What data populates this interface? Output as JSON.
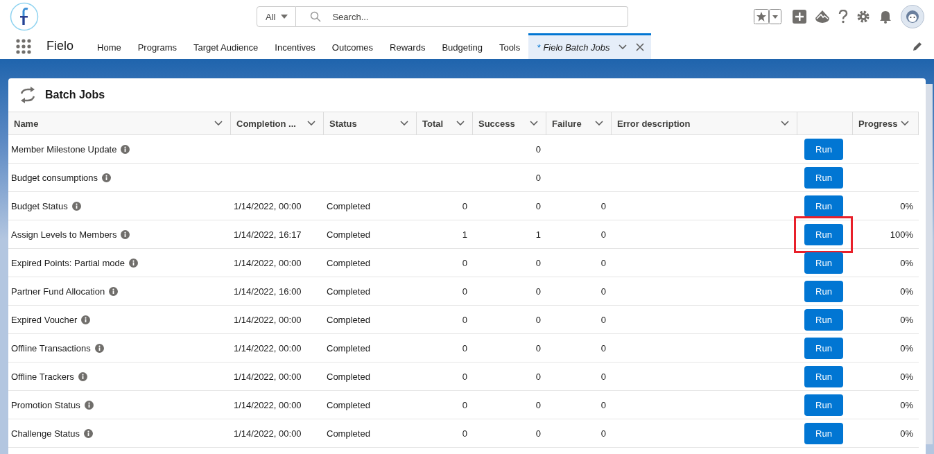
{
  "app": {
    "name": "Fielo"
  },
  "search": {
    "scope": "All",
    "placeholder": "Search..."
  },
  "nav": [
    {
      "label": "Home",
      "selected": false
    },
    {
      "label": "Programs",
      "selected": false
    },
    {
      "label": "Target Audience",
      "selected": false
    },
    {
      "label": "Incentives",
      "selected": false
    },
    {
      "label": "Outcomes",
      "selected": false
    },
    {
      "label": "Rewards",
      "selected": false
    },
    {
      "label": "Budgeting",
      "selected": false
    },
    {
      "label": "Tools",
      "selected": false
    },
    {
      "label": "Fielo Batch Jobs",
      "selected": true,
      "unsaved_mark": "*"
    }
  ],
  "card": {
    "title": "Batch Jobs"
  },
  "table": {
    "columns": [
      {
        "label": "Name",
        "kind": "text"
      },
      {
        "label": "Completion ...",
        "kind": "text"
      },
      {
        "label": "Status",
        "kind": "text"
      },
      {
        "label": "Total",
        "kind": "number"
      },
      {
        "label": "Success",
        "kind": "number"
      },
      {
        "label": "Failure",
        "kind": "number"
      },
      {
        "label": "Error description",
        "kind": "text"
      },
      {
        "kind": "action"
      },
      {
        "label": "Progress",
        "kind": "number"
      }
    ],
    "rows": [
      {
        "name": "Member Milestone Update",
        "success": "0",
        "action": "Run",
        "highlighted": false
      },
      {
        "name": "Budget consumptions",
        "success": "0",
        "action": "Run",
        "highlighted": false
      },
      {
        "name": "Budget Status",
        "completion": "1/14/2022, 00:00",
        "status": "Completed",
        "total": "0",
        "success": "0",
        "failure": "0",
        "action": "Run",
        "progress": "0%",
        "highlighted": false
      },
      {
        "name": "Assign Levels to Members",
        "completion": "1/14/2022, 16:17",
        "status": "Completed",
        "total": "1",
        "success": "1",
        "failure": "0",
        "action": "Run",
        "progress": "100%",
        "highlighted": true
      },
      {
        "name": "Expired Points: Partial mode",
        "completion": "1/14/2022, 00:00",
        "status": "Completed",
        "total": "0",
        "success": "0",
        "failure": "0",
        "action": "Run",
        "progress": "0%",
        "highlighted": false
      },
      {
        "name": "Partner Fund Allocation",
        "completion": "1/14/2022, 16:00",
        "status": "Completed",
        "total": "0",
        "success": "0",
        "failure": "0",
        "action": "Run",
        "progress": "0%",
        "highlighted": false
      },
      {
        "name": "Expired Voucher",
        "completion": "1/14/2022, 00:00",
        "status": "Completed",
        "total": "0",
        "success": "0",
        "failure": "0",
        "action": "Run",
        "progress": "0%",
        "highlighted": false
      },
      {
        "name": "Offline Transactions",
        "completion": "1/14/2022, 00:00",
        "status": "Completed",
        "total": "0",
        "success": "0",
        "failure": "0",
        "action": "Run",
        "progress": "0%",
        "highlighted": false
      },
      {
        "name": "Offline Trackers",
        "completion": "1/14/2022, 00:00",
        "status": "Completed",
        "total": "0",
        "success": "0",
        "failure": "0",
        "action": "Run",
        "progress": "0%",
        "highlighted": false
      },
      {
        "name": "Promotion Status",
        "completion": "1/14/2022, 00:00",
        "status": "Completed",
        "total": "0",
        "success": "0",
        "failure": "0",
        "action": "Run",
        "progress": "0%",
        "highlighted": false
      },
      {
        "name": "Challenge Status",
        "completion": "1/14/2022, 00:00",
        "status": "Completed",
        "total": "0",
        "success": "0",
        "failure": "0",
        "action": "Run",
        "progress": "0%",
        "highlighted": false
      }
    ]
  }
}
